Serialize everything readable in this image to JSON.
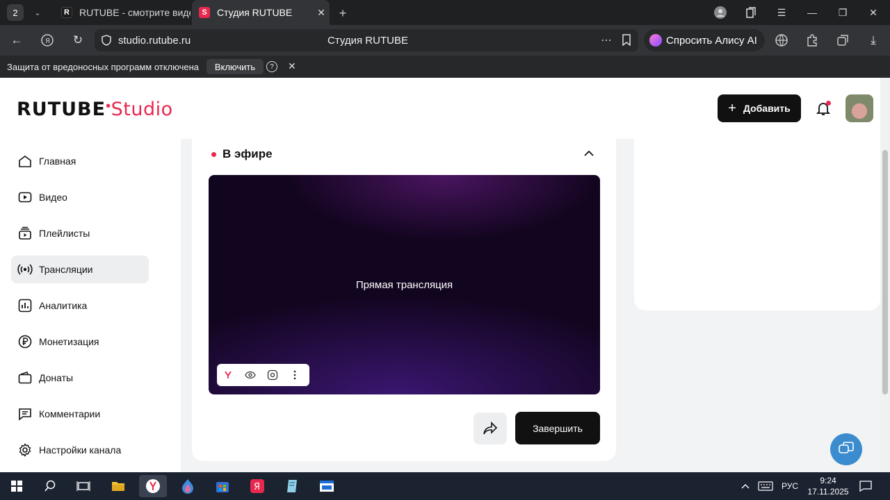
{
  "browser": {
    "tab_count": "2",
    "tabs": [
      {
        "title": "RUTUBE - смотрите виде",
        "active": false
      },
      {
        "title": "Студия RUTUBE",
        "active": true
      }
    ],
    "url": "studio.rutube.ru",
    "page_title": "Студия RUTUBE",
    "alice_label": "Спросить Алису AI",
    "infobar": {
      "text": "Защита от вредоносных программ отключена",
      "enable_label": "Включить",
      "help_label": "?"
    }
  },
  "app": {
    "logo_main": "RUTUBE",
    "logo_studio": "Studio",
    "add_button": "Добавить",
    "brand_color": "#e8284f"
  },
  "sidebar": {
    "items": [
      {
        "label": "Главная",
        "icon": "home-icon"
      },
      {
        "label": "Видео",
        "icon": "video-icon"
      },
      {
        "label": "Плейлисты",
        "icon": "playlist-icon"
      },
      {
        "label": "Трансляции",
        "icon": "broadcast-icon",
        "active": true
      },
      {
        "label": "Аналитика",
        "icon": "analytics-icon"
      },
      {
        "label": "Монетизация",
        "icon": "ruble-icon"
      },
      {
        "label": "Донаты",
        "icon": "wallet-icon"
      },
      {
        "label": "Комментарии",
        "icon": "comment-icon"
      },
      {
        "label": "Настройки канала",
        "icon": "gear-icon"
      }
    ]
  },
  "live": {
    "status_label": "В эфире",
    "player_title": "Прямая трансляция",
    "end_button": "Завершить"
  },
  "taskbar": {
    "language": "РУС",
    "time": "9:24",
    "date": "17.11.2025"
  }
}
